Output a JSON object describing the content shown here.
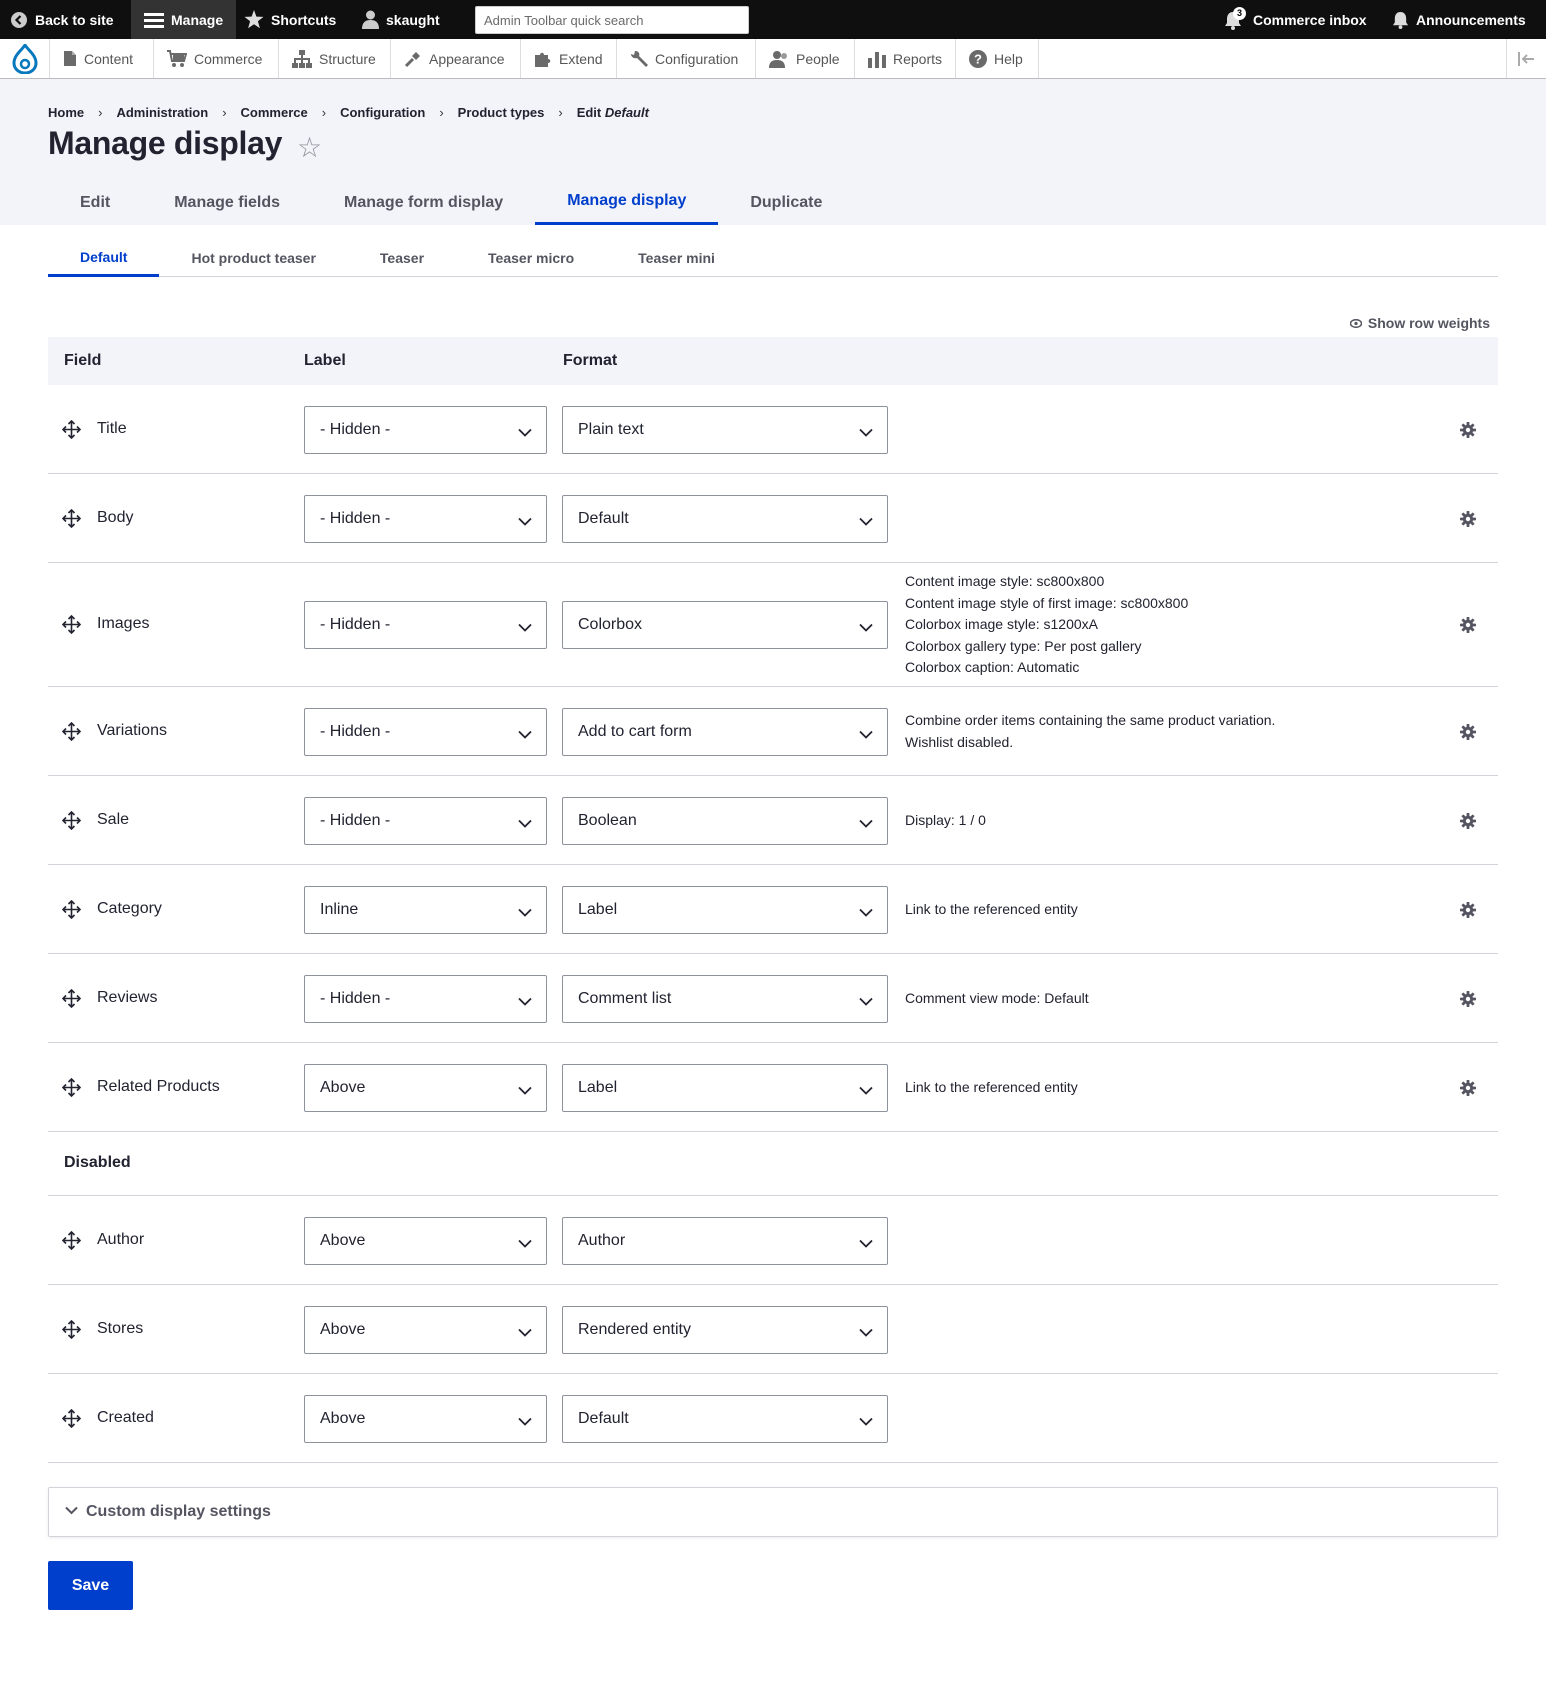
{
  "toolbar": {
    "back_label": "Back to site",
    "manage_label": "Manage",
    "shortcuts_label": "Shortcuts",
    "user_label": "skaught",
    "search_placeholder": "Admin Toolbar quick search",
    "inbox_label": "Commerce inbox",
    "inbox_count": "3",
    "announcements_label": "Announcements"
  },
  "nav": {
    "items": [
      {
        "label": "Content",
        "icon": "document-icon"
      },
      {
        "label": "Commerce",
        "icon": "cart-icon"
      },
      {
        "label": "Structure",
        "icon": "sitemap-icon"
      },
      {
        "label": "Appearance",
        "icon": "paint-icon"
      },
      {
        "label": "Extend",
        "icon": "puzzle-icon"
      },
      {
        "label": "Configuration",
        "icon": "wrench-icon"
      },
      {
        "label": "People",
        "icon": "people-icon"
      },
      {
        "label": "Reports",
        "icon": "bar-chart-icon"
      },
      {
        "label": "Help",
        "icon": "help-icon"
      }
    ]
  },
  "breadcrumb": {
    "items": [
      "Home",
      "Administration",
      "Commerce",
      "Configuration",
      "Product types"
    ],
    "current_prefix": "Edit",
    "current_em": "Default"
  },
  "page_title": "Manage display",
  "primary_tabs": [
    "Edit",
    "Manage fields",
    "Manage form display",
    "Manage display",
    "Duplicate"
  ],
  "secondary_tabs": [
    "Default",
    "Hot product teaser",
    "Teaser",
    "Teaser micro",
    "Teaser mini"
  ],
  "row_weights_label": "Show row weights",
  "table": {
    "headers": {
      "field": "Field",
      "label": "Label",
      "format": "Format"
    },
    "rows": [
      {
        "name": "Title",
        "label": "- Hidden -",
        "format": "Plain text",
        "summary": []
      },
      {
        "name": "Body",
        "label": "- Hidden -",
        "format": "Default",
        "summary": []
      },
      {
        "name": "Images",
        "label": "- Hidden -",
        "format": "Colorbox",
        "summary": [
          "Content image style: sc800x800",
          "Content image style of first image: sc800x800",
          "Colorbox image style: s1200xA",
          "Colorbox gallery type: Per post gallery",
          "Colorbox caption: Automatic"
        ]
      },
      {
        "name": "Variations",
        "label": "- Hidden -",
        "format": "Add to cart form",
        "summary": [
          "Combine order items containing the same product variation.",
          "Wishlist disabled."
        ]
      },
      {
        "name": "Sale",
        "label": "- Hidden -",
        "format": "Boolean",
        "summary": [
          "Display: 1 / 0"
        ]
      },
      {
        "name": "Category",
        "label": "Inline",
        "format": "Label",
        "summary": [
          "Link to the referenced entity"
        ]
      },
      {
        "name": "Reviews",
        "label": "- Hidden -",
        "format": "Comment list",
        "summary": [
          "Comment view mode: Default"
        ]
      },
      {
        "name": "Related Products",
        "label": "Above",
        "format": "Label",
        "summary": [
          "Link to the referenced entity"
        ]
      }
    ],
    "disabled_title": "Disabled",
    "disabled_rows": [
      {
        "name": "Author",
        "label": "Above",
        "format": "Author"
      },
      {
        "name": "Stores",
        "label": "Above",
        "format": "Rendered entity"
      },
      {
        "name": "Created",
        "label": "Above",
        "format": "Default"
      }
    ]
  },
  "custom_display_settings": "Custom display settings",
  "save_label": "Save",
  "colors": {
    "accent": "#003ecc",
    "toolbar_bg": "#0f0f0f",
    "header_bg": "#f3f4f9"
  }
}
